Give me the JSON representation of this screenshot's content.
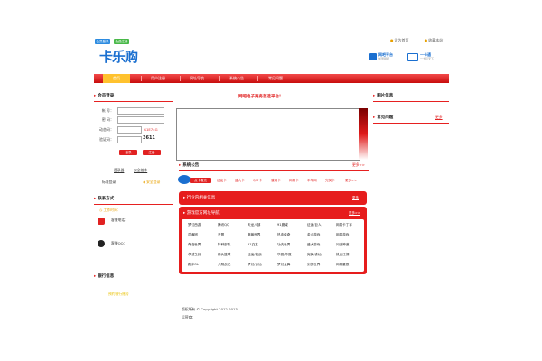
{
  "top_buttons": [
    "会员登录",
    "免费注册"
  ],
  "logo": {
    "text": "卡乐购"
  },
  "top_links": [
    "设为首页",
    "收藏本站"
  ],
  "promos": [
    {
      "title": "网吧平台",
      "sub": "加盟网吧"
    },
    {
      "title": "一卡通",
      "sub": "一卡玩天下"
    }
  ],
  "nav": [
    "首页",
    "用户注册",
    "网址导航",
    "系统公告",
    "常见问题"
  ],
  "member_login": {
    "title": "会员登录",
    "account_label": "帐  号：",
    "password_label": "密  码：",
    "dynamic_label": "动态码：",
    "dynamic_code": "G1E74G",
    "captcha_label": "验证码：",
    "captcha_image": "3611",
    "login_btn": "登录",
    "reset_btn": "注册",
    "links": [
      "登录器",
      "安全控件"
    ],
    "standard_login": "标准登录",
    "safe_login": "安全登录"
  },
  "contact": {
    "title": "联系方式",
    "hours": "工作时间：",
    "phone": "客服电话：",
    "qq": "客服QQ："
  },
  "bank_info": {
    "title": "银行信息",
    "content": "预约银行账号"
  },
  "banner_text": "网吧电子商务首选平台!",
  "system_notice": {
    "title": "系统公告",
    "more": "更多>>"
  },
  "cards": {
    "badge": "点卡直充",
    "tabs": [
      "征途卡",
      "盛大卡",
      "Q币卡",
      "骏网卡",
      "网易卡",
      "中华网",
      "完美卡",
      "更多>>"
    ]
  },
  "industry": {
    "title": "行业内相关信息",
    "more": "更多"
  },
  "game_nav": {
    "title": "游戏官方网址导航",
    "more": "更多>>",
    "rows": [
      [
        "梦幻西游",
        "腾讯QQ",
        "天龙八部",
        "91魔域",
        "征途/巨人",
        "网易卡丁车"
      ],
      [
        "劲舞团",
        "开冒",
        "魔兽世界",
        "热血传奇",
        "金山游戏",
        "网易游戏"
      ],
      [
        "奇迹世界",
        "特种部队",
        "51交友",
        "功夫世界",
        "盛大游戏",
        "问道神道"
      ],
      [
        "卓越之剑",
        "街头篮球",
        "征途/机战",
        "华夏/华夏",
        "完美/诛仙",
        "热血江湖"
      ],
      [
        "跑车OL",
        "九阴战记",
        "梦幻/诛仙",
        "梦幻龙舞",
        "剑侠世界",
        "网易星辰"
      ]
    ]
  },
  "pictures": {
    "title": "图片信息"
  },
  "faq": {
    "title": "常见问题",
    "more": "更多"
  },
  "footer": {
    "copyright": "版权所有 © Copyright 2012-2013",
    "operator": "运营商："
  }
}
